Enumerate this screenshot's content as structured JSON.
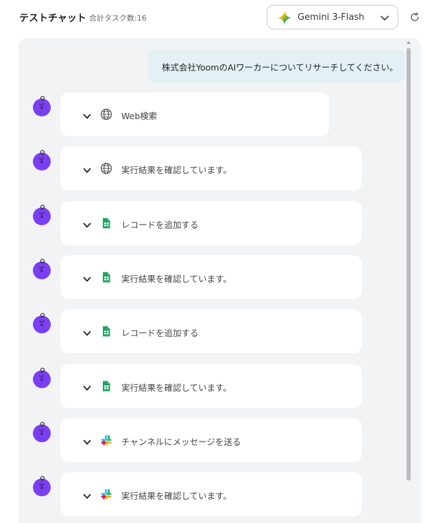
{
  "header": {
    "title": "テストチャット",
    "task_count": "合計タスク数:16"
  },
  "model_selector": {
    "label": "Gemini 3-Flash",
    "icon": "gemini-sparkle-icon"
  },
  "refresh": {
    "icon": "refresh-icon"
  },
  "user_message": {
    "text": "株式会社YoomのAIワーカーについてリサーチしてください。"
  },
  "colors": {
    "avatar": "#7b3ff2",
    "chat_bg": "#f2f3f5",
    "user_bubble": "#e3f1f5",
    "sheets_green": "#1fa463"
  },
  "steps": [
    {
      "icon": "globe-icon",
      "label": "Web検索"
    },
    {
      "icon": "globe-icon",
      "label": "実行結果を確認しています。"
    },
    {
      "icon": "google-sheets-icon",
      "label": "レコードを追加する"
    },
    {
      "icon": "google-sheets-icon",
      "label": "実行結果を確認しています。"
    },
    {
      "icon": "google-sheets-icon",
      "label": "レコードを追加する"
    },
    {
      "icon": "google-sheets-icon",
      "label": "実行結果を確認しています。"
    },
    {
      "icon": "slack-icon",
      "label": "チャンネルにメッセージを送る"
    },
    {
      "icon": "slack-icon",
      "label": "実行結果を確認しています。"
    }
  ]
}
